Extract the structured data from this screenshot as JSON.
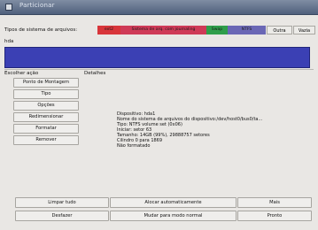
{
  "window": {
    "title": "Particionar"
  },
  "filesystems": {
    "label": "Tipos de sistema de arquivos:",
    "legend": [
      {
        "name": "ext2",
        "color": "#d8353a"
      },
      {
        "name": "Sistema de arq. com journaling",
        "color": "#cf3a57"
      },
      {
        "name": "Swap",
        "color": "#2f9e4a"
      },
      {
        "name": "NTFS",
        "color": "#6a67b5"
      }
    ],
    "other_label": "Outra",
    "empty_label": "Vazia"
  },
  "device": {
    "name": "hda",
    "bar_color": "#3b40b4"
  },
  "actions": {
    "header": "Escolher ação",
    "buttons": [
      "Ponto de Montagem",
      "Tipo",
      "Opções",
      "Redimensionar",
      "Formatar",
      "Remover"
    ]
  },
  "details": {
    "header": "Detalhes",
    "lines": [
      "Dispositivo: hda1",
      "Nome do sistema de arquivos do dispositivo:/dev/host0/bus0/ta...",
      "Tipo: NTFS volume set (0x06)",
      "Iniciar: setor 63",
      "Tamanho: 14GB (99%), 29888757 setores",
      "Cilindro 0 para 1869",
      "Não formatado"
    ]
  },
  "bottom_buttons": {
    "clear_all": "Limpar tudo",
    "auto_allocate": "Alocar automaticamente",
    "more": "Mais",
    "undo": "Desfazer",
    "normal_mode": "Mudar para modo normal",
    "done": "Pronto"
  }
}
